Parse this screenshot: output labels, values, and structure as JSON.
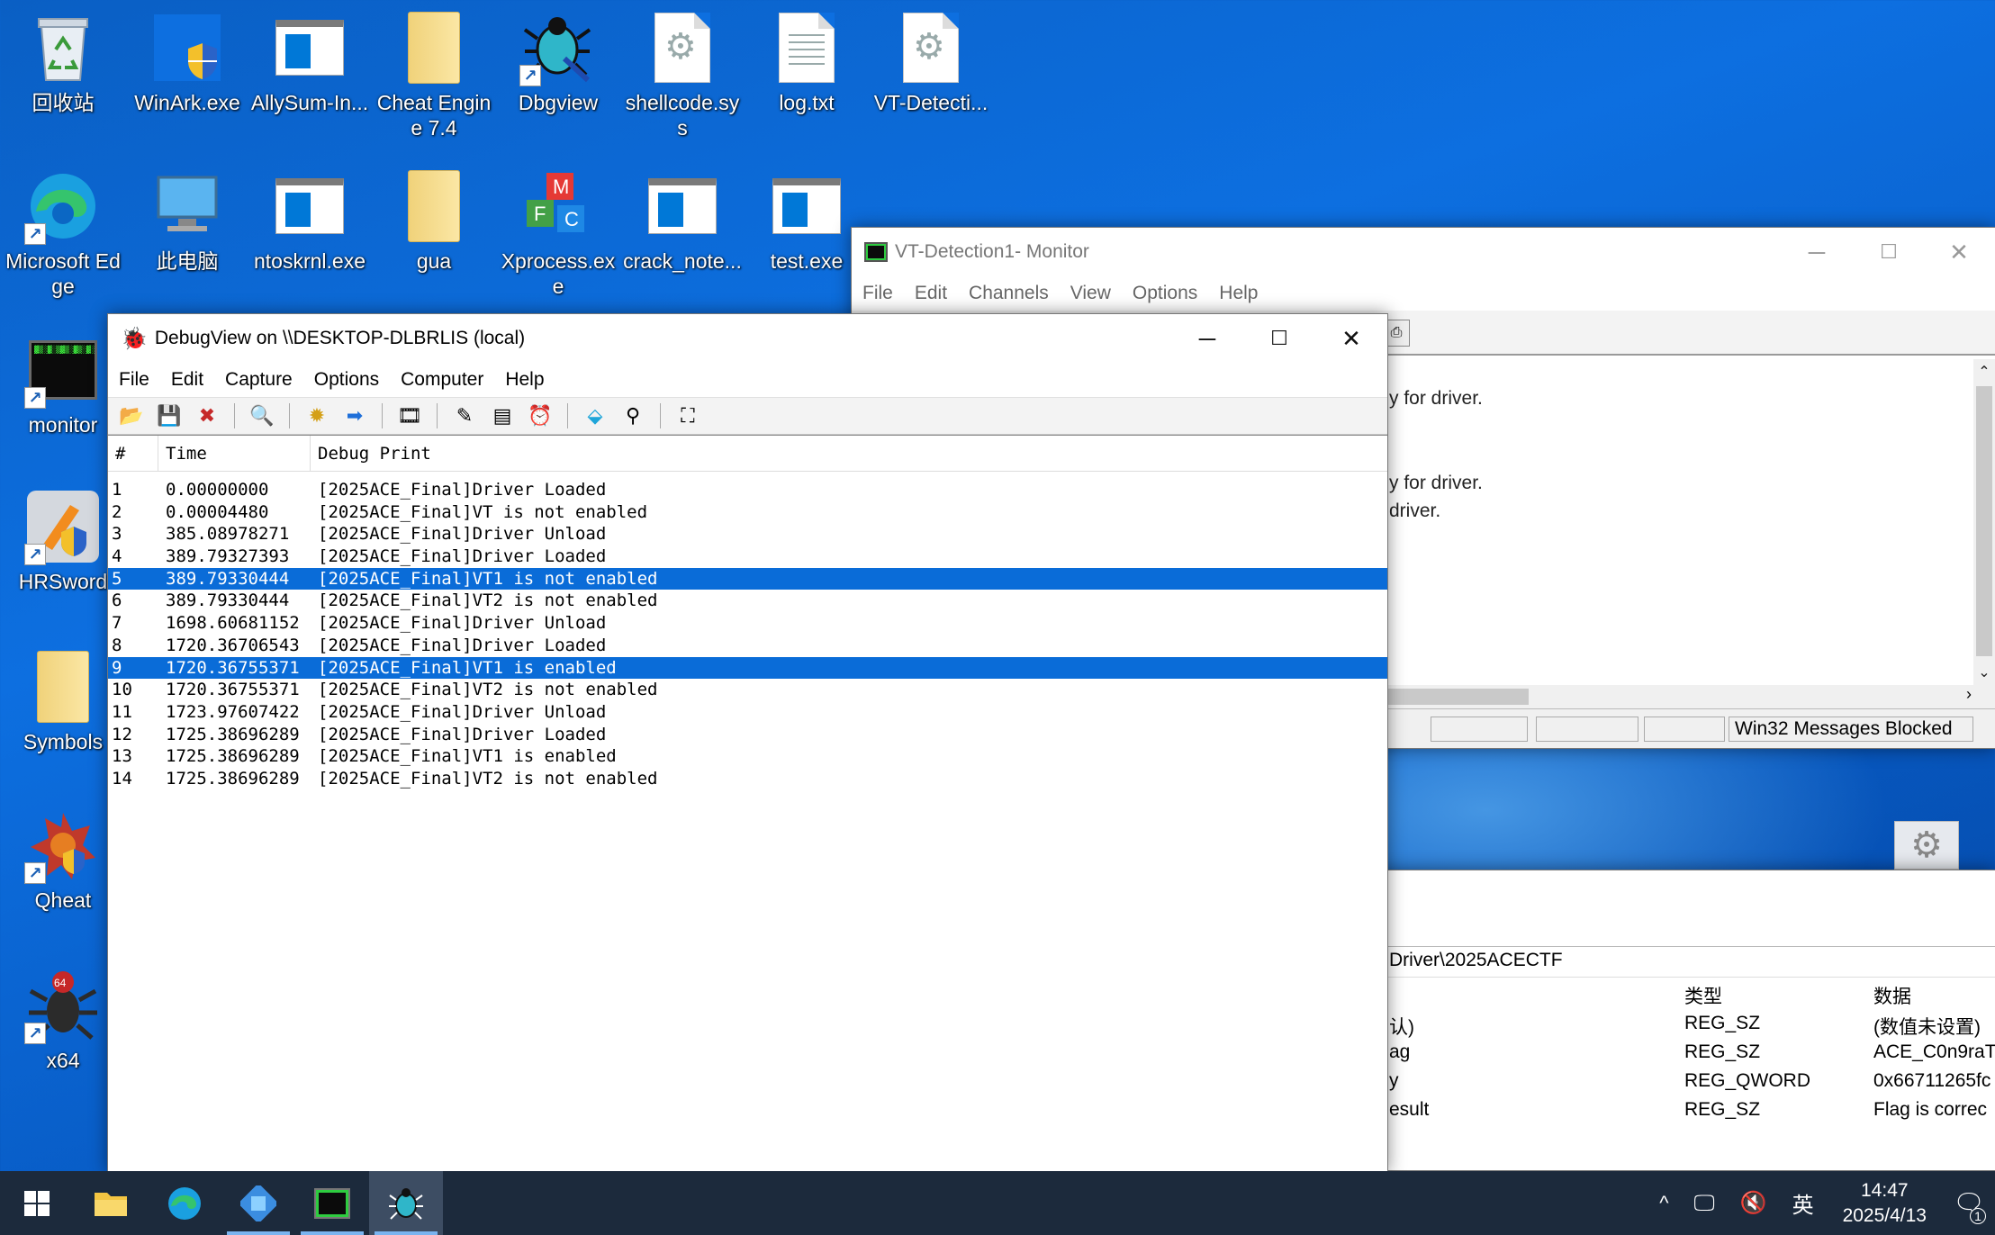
{
  "desktop": {
    "icons": [
      {
        "label": "回收站",
        "icon": "recycle-bin-icon"
      },
      {
        "label": "WinArk.exe",
        "icon": "winark-icon"
      },
      {
        "label": "AllySum-In...",
        "icon": "exe-icon"
      },
      {
        "label": "Cheat Engine 7.4",
        "icon": "folder-icon"
      },
      {
        "label": "Dbgview",
        "icon": "dbgview-icon"
      },
      {
        "label": "shellcode.sys",
        "icon": "sys-file-icon"
      },
      {
        "label": "log.txt",
        "icon": "text-file-icon"
      },
      {
        "label": "VT-Detecti...",
        "icon": "sys-file-icon"
      },
      {
        "label": "Microsoft Edge",
        "icon": "edge-icon"
      },
      {
        "label": "此电脑",
        "icon": "computer-icon"
      },
      {
        "label": "ntoskrnl.exe",
        "icon": "exe-icon"
      },
      {
        "label": "gua",
        "icon": "folder-icon"
      },
      {
        "label": "Xprocess.exe",
        "icon": "xprocess-icon"
      },
      {
        "label": "crack_note...",
        "icon": "exe-icon"
      },
      {
        "label": "test.exe",
        "icon": "exe-icon"
      },
      {
        "label": "monitor",
        "icon": "monitor-icon"
      },
      {
        "label": "HRSword",
        "icon": "hrsword-icon"
      },
      {
        "label": "Symbols",
        "icon": "folder-icon"
      },
      {
        "label": "Qheat",
        "icon": "qheat-icon"
      },
      {
        "label": "x64",
        "icon": "x64-bug-icon"
      }
    ]
  },
  "monitor_window": {
    "title": "VT-Detection1- Monitor",
    "menu": [
      "File",
      "Edit",
      "Channels",
      "View",
      "Options",
      "Help"
    ],
    "lines": [
      "y for driver.",
      "y for driver.",
      "driver."
    ],
    "status_text": "Win32 Messages Blocked"
  },
  "regedit": {
    "path": "Driver\\2025ACECTF",
    "headers": {
      "type": "类型",
      "data": "数据"
    },
    "rows": [
      {
        "name": "认)",
        "type": "REG_SZ",
        "data": "(数值未设置)"
      },
      {
        "name": "ag",
        "type": "REG_SZ",
        "data": "ACE_C0n9raT"
      },
      {
        "name": "y",
        "type": "REG_QWORD",
        "data": "0x66711265fc"
      },
      {
        "name": "esult",
        "type": "REG_SZ",
        "data": "Flag is correc"
      }
    ]
  },
  "debugview": {
    "title": "DebugView on \\\\DESKTOP-DLBRLIS (local)",
    "menu": [
      "File",
      "Edit",
      "Capture",
      "Options",
      "Computer",
      "Help"
    ],
    "columns": {
      "num": "#",
      "time": "Time",
      "print": "Debug Print"
    },
    "rows": [
      {
        "n": "1",
        "t": "0.00000000",
        "p": "[2025ACE_Final]Driver Loaded",
        "selected": false
      },
      {
        "n": "2",
        "t": "0.00004480",
        "p": "[2025ACE_Final]VT is not enabled",
        "selected": false
      },
      {
        "n": "3",
        "t": "385.08978271",
        "p": "[2025ACE_Final]Driver Unload",
        "selected": false
      },
      {
        "n": "4",
        "t": "389.79327393",
        "p": "[2025ACE_Final]Driver Loaded",
        "selected": false
      },
      {
        "n": "5",
        "t": "389.79330444",
        "p": "[2025ACE_Final]VT1 is not enabled",
        "selected": true
      },
      {
        "n": "6",
        "t": "389.79330444",
        "p": "[2025ACE_Final]VT2 is not enabled",
        "selected": false
      },
      {
        "n": "7",
        "t": "1698.60681152",
        "p": "[2025ACE_Final]Driver Unload",
        "selected": false
      },
      {
        "n": "8",
        "t": "1720.36706543",
        "p": "[2025ACE_Final]Driver Loaded",
        "selected": false
      },
      {
        "n": "9",
        "t": "1720.36755371",
        "p": "[2025ACE_Final]VT1 is enabled",
        "selected": true
      },
      {
        "n": "10",
        "t": "1720.36755371",
        "p": "[2025ACE_Final]VT2 is not enabled",
        "selected": false
      },
      {
        "n": "11",
        "t": "1723.97607422",
        "p": "[2025ACE_Final]Driver Unload",
        "selected": false
      },
      {
        "n": "12",
        "t": "1725.38696289",
        "p": "[2025ACE_Final]Driver Loaded",
        "selected": false
      },
      {
        "n": "13",
        "t": "1725.38696289",
        "p": "[2025ACE_Final]VT1 is enabled",
        "selected": false
      },
      {
        "n": "14",
        "t": "1725.38696289",
        "p": "[2025ACE_Final]VT2 is not enabled",
        "selected": false
      }
    ]
  },
  "taskbar": {
    "apps": [
      "start-icon",
      "file-explorer-icon",
      "edge-icon",
      "allysum-icon",
      "monitor-icon",
      "dbgview-icon"
    ],
    "tray": {
      "chevron": "^",
      "ime": "英",
      "time": "14:47",
      "date": "2025/4/13",
      "notification_count": "1"
    }
  },
  "colors": {
    "selection": "#0a6cd8",
    "desktop": "#0d6fe0",
    "taskbar": "#1c2a3c"
  }
}
